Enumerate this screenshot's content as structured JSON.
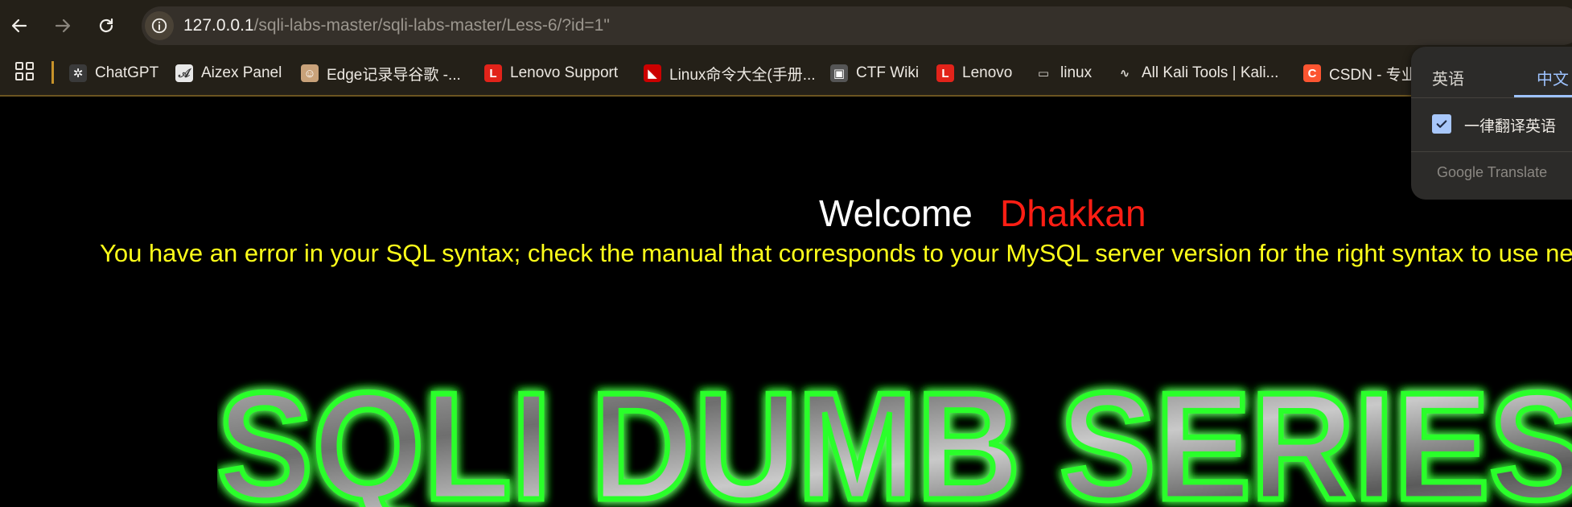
{
  "toolbar": {
    "url_host": "127.0.0.1",
    "url_path": "/sqli-labs-master/sqli-labs-master/Less-6/?id=1\""
  },
  "bookmarks": [
    {
      "label": "ChatGPT",
      "icon": "chatgpt-icon",
      "color": "#3a3a3a"
    },
    {
      "label": "Aizex Panel",
      "icon": "aizex-icon",
      "color": "#e8e8e8"
    },
    {
      "label": "Edge记录导谷歌 -...",
      "icon": "avatar-icon",
      "color": "#c9a27a"
    },
    {
      "label": "Lenovo Support",
      "icon": "lenovo-icon",
      "color": "#e2231a"
    },
    {
      "label": "Linux命令大全(手册...",
      "icon": "redhat-icon",
      "color": "#cc0000"
    },
    {
      "label": "CTF Wiki",
      "icon": "ctf-wiki-icon",
      "color": "#555555"
    },
    {
      "label": "Lenovo",
      "icon": "lenovo-icon",
      "color": "#e2231a"
    },
    {
      "label": "linux",
      "icon": "folder-icon",
      "color": "#d9d6d0"
    },
    {
      "label": "All Kali Tools | Kali...",
      "icon": "kali-icon",
      "color": "#d9d6d0"
    },
    {
      "label": "CSDN - 专业",
      "icon": "csdn-icon",
      "color": "#fc5531"
    }
  ],
  "page": {
    "welcome": "Welcome",
    "name": "Dhakkan",
    "error": "You have an error in your SQL syntax; check the manual that corresponds to your MySQL server version for the right syntax to use ne",
    "banner": "SQLI DUMB SERIES"
  },
  "translate": {
    "tab_source": "英语",
    "tab_target": "中文",
    "always_label": "一律翻译英语",
    "footer": "Google Translate"
  }
}
